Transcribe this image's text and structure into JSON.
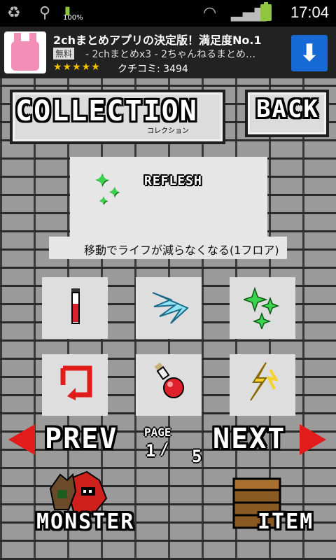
{
  "status_bar": {
    "battery_percent": "100%",
    "time": "17:04"
  },
  "ad": {
    "title": "2chまとめアプリの決定版！満足度No.1",
    "free_badge": "無料",
    "subtitle": "- 2chまとめx3 - 2ちゃんねるまとめ…",
    "stars": "★★★★★",
    "review": "クチコミ: 3494",
    "download_icon": "download-arrow-icon"
  },
  "header": {
    "title": "COLLECTION",
    "title_sub": "コレクション",
    "back_label": "BACK"
  },
  "detail": {
    "item_name": "REFLESH",
    "description": "移動でライフが減らなくなる(1フロア)",
    "icon": "sparkle-icon"
  },
  "grid": {
    "items": [
      {
        "icon": "test-tube-icon"
      },
      {
        "icon": "wing-icon"
      },
      {
        "icon": "sparkle-icon"
      },
      {
        "icon": "reload-icon"
      },
      {
        "icon": "red-potion-icon"
      },
      {
        "icon": "lightning-icon"
      }
    ]
  },
  "pagination": {
    "prev_label": "PREV",
    "next_label": "NEXT",
    "page_label": "PAGE",
    "current": "1",
    "separator": "/",
    "total": "5"
  },
  "footer": {
    "monster_label": "MONSTER",
    "item_label": "ITEM"
  },
  "colors": {
    "accent_red": "#e21b1b",
    "sparkle_green": "#3bd24e",
    "ad_blue": "#1769d6"
  }
}
